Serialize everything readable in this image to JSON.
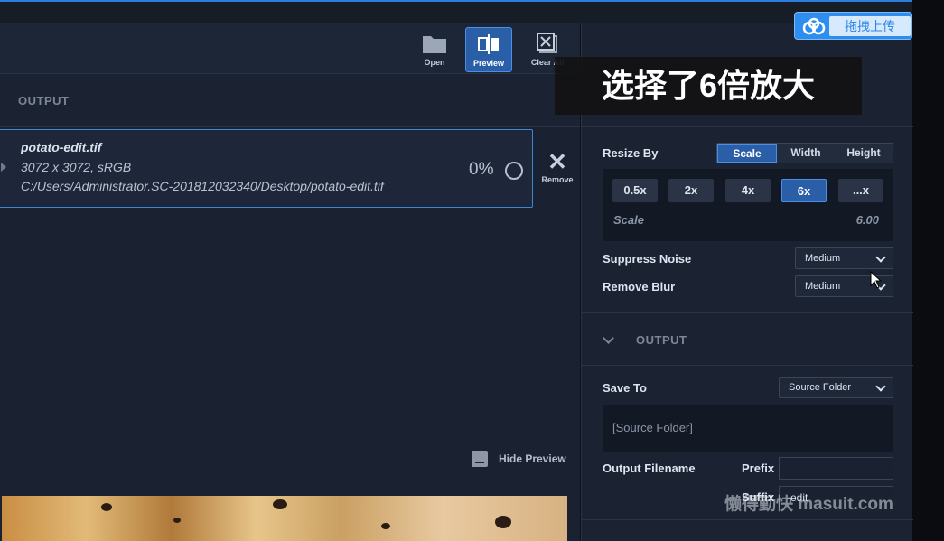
{
  "toolbar": {
    "open_label": "Open",
    "preview_label": "Preview",
    "clear_all_label": "Clear All",
    "active": "Preview"
  },
  "output_panel": {
    "header": "OUTPUT",
    "file": {
      "name": "potato-edit.tif",
      "details": "3072 x 3072, sRGB",
      "path": "C:/Users/Administrator.SC-201812032340/Desktop/potato-edit.tif",
      "progress": "0%"
    },
    "remove_label": "Remove",
    "hide_preview_label": "Hide Preview"
  },
  "settings": {
    "resize_by_label": "Resize By",
    "resize_modes": [
      "Scale",
      "Width",
      "Height"
    ],
    "resize_mode_selected": "Scale",
    "scale_buttons": [
      "0.5x",
      "2x",
      "4x",
      "6x",
      "...x"
    ],
    "scale_selected": "6x",
    "scale_label": "Scale",
    "scale_value": "6.00",
    "suppress_noise_label": "Suppress Noise",
    "suppress_noise_value": "Medium",
    "remove_blur_label": "Remove Blur",
    "remove_blur_value": "Medium"
  },
  "output_settings": {
    "header": "OUTPUT",
    "save_to_label": "Save To",
    "save_to_value": "Source Folder",
    "path_display": "[Source Folder]",
    "output_filename_label": "Output Filename",
    "prefix_label": "Prefix",
    "suffix_label": "Suffix",
    "suffix_value": "-edit"
  },
  "overlays": {
    "upload_button": "拖拽上传",
    "caption": "选择了6倍放大",
    "watermark": "懒得勤快 masuit.com"
  },
  "colors": {
    "accent": "#2a5fa8",
    "accent_border": "#4b8ee6",
    "panel_bg": "#1b2333"
  }
}
